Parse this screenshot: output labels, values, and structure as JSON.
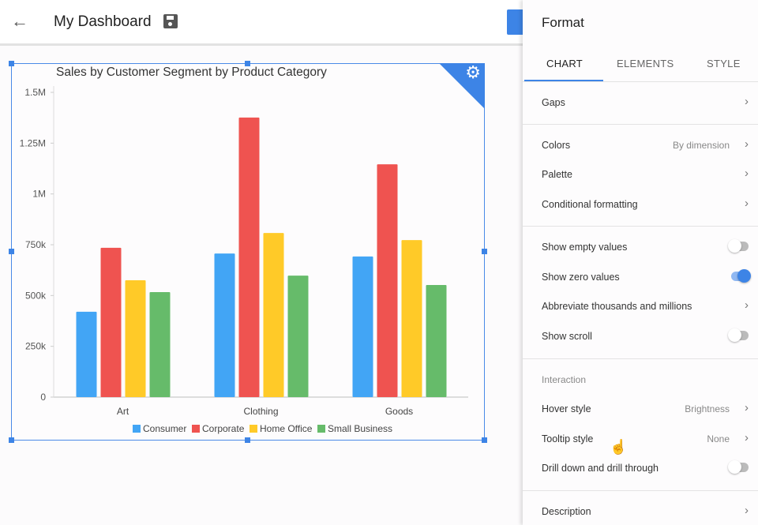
{
  "header": {
    "title": "My Dashboard"
  },
  "chart_data": {
    "type": "bar",
    "title": "Sales by Customer Segment by Product Category",
    "categories": [
      "Art",
      "Clothing",
      "Goods"
    ],
    "series": [
      {
        "name": "Consumer",
        "color": "#42a5f5",
        "values": [
          420000,
          707000,
          692000
        ]
      },
      {
        "name": "Corporate",
        "color": "#ef5350",
        "values": [
          735000,
          1376000,
          1146000
        ]
      },
      {
        "name": "Home Office",
        "color": "#ffca28",
        "values": [
          575000,
          808000,
          773000
        ]
      },
      {
        "name": "Small Business",
        "color": "#66bb6a",
        "values": [
          517000,
          598000,
          552000
        ]
      }
    ],
    "yticks": [
      "0",
      "250k",
      "500k",
      "750k",
      "1M",
      "1.25M",
      "1.5M"
    ],
    "ylim": [
      0,
      1500000
    ],
    "legend": "bottom"
  },
  "panel": {
    "title": "Format",
    "tabs": [
      "CHART",
      "ELEMENTS",
      "STYLE"
    ],
    "rows": {
      "gaps": "Gaps",
      "colors": "Colors",
      "colors_value": "By dimension",
      "palette": "Palette",
      "conditional": "Conditional formatting",
      "show_empty": "Show empty values",
      "show_zero": "Show zero values",
      "abbreviate": "Abbreviate thousands and millions",
      "show_scroll": "Show scroll",
      "interaction": "Interaction",
      "hover": "Hover style",
      "hover_value": "Brightness",
      "tooltip": "Tooltip style",
      "tooltip_value": "None",
      "drill": "Drill down and drill through",
      "description": "Description"
    },
    "toggles": {
      "show_empty": false,
      "show_zero": true,
      "show_scroll": false,
      "drill": false
    }
  }
}
